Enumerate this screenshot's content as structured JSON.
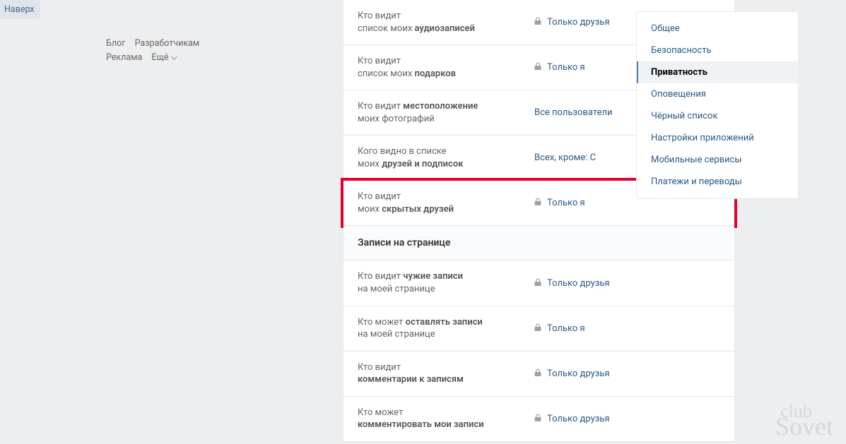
{
  "top": {
    "naverh": "Наверх"
  },
  "footer_nav": {
    "blog": "Блог",
    "devs": "Разработчикам",
    "ads": "Реклама",
    "more": "Ещё"
  },
  "settings": [
    {
      "label_pre": "Кто видит",
      "label_post": "список моих ",
      "label_bold": "аудиозаписей",
      "value": "Только друзья",
      "lock": true
    },
    {
      "label_pre": "Кто видит",
      "label_post": "список моих ",
      "label_bold": "подарков",
      "value": "Только я",
      "lock": true
    },
    {
      "label_pre": "Кто видит ",
      "label_bold_inline": "местоположение",
      "label_post2": "моих фотографий",
      "value": "Все пользователи",
      "lock": false
    },
    {
      "label_pre": "Кого видно в списке",
      "label_post": "моих ",
      "label_bold": "друзей и подписок",
      "value": "Всех, кроме: С",
      "lock": false
    },
    {
      "label_pre": "Кто видит",
      "label_post": "моих ",
      "label_bold": "скрытых друзей",
      "value": "Только я",
      "lock": true,
      "highlight": true
    }
  ],
  "section2_title": "Записи на странице",
  "settings2": [
    {
      "label_pre": "Кто видит ",
      "label_bold_inline": "чужие записи",
      "label_post2": "на моей странице",
      "value": "Только друзья",
      "lock": true
    },
    {
      "label_pre": "Кто может ",
      "label_bold_inline": "оставлять записи",
      "label_post2": "на моей странице",
      "value": "Только я",
      "lock": true
    },
    {
      "label_pre": "Кто видит",
      "label_bold_block": "комментарии к записям",
      "value": "Только друзья",
      "lock": true
    },
    {
      "label_pre": "Кто может",
      "label_bold_block": "комментировать мои записи",
      "value": "Только друзья",
      "lock": true
    }
  ],
  "sidebar": {
    "items": [
      {
        "label": "Общее"
      },
      {
        "label": "Безопасность"
      },
      {
        "label": "Приватность",
        "active": true
      },
      {
        "label": "Оповещения"
      },
      {
        "label": "Чёрный список"
      },
      {
        "label": "Настройки приложений"
      },
      {
        "label": "Мобильные сервисы"
      },
      {
        "label": "Платежи и переводы"
      }
    ]
  },
  "watermark": {
    "line1": "club",
    "line2": "Sovet"
  }
}
